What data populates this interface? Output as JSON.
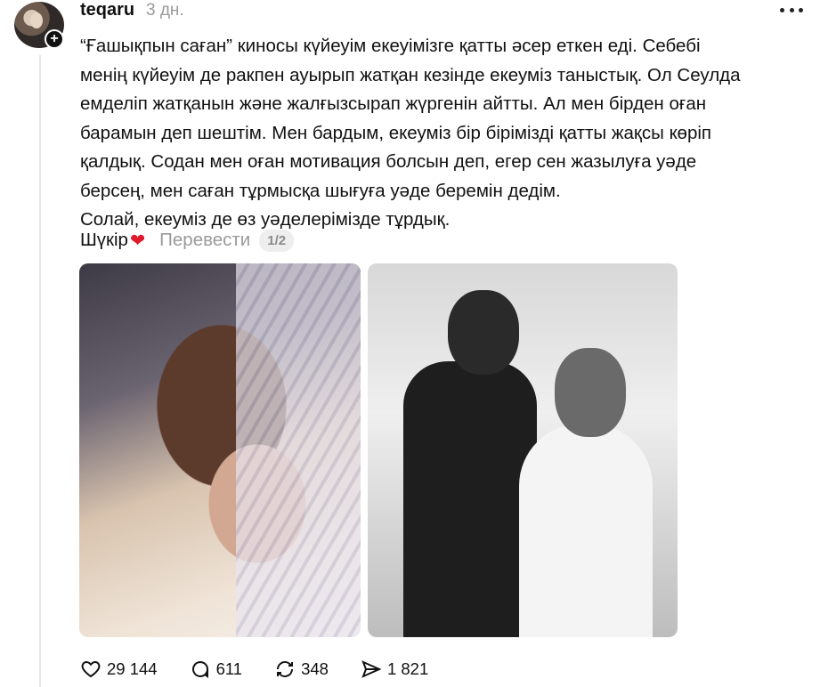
{
  "post": {
    "username": "teqaru",
    "timestamp": "3 дн.",
    "text": "“Ғашықпын саған” киносы күйеуім екеуімізге қатты әсер еткен еді. Себебі\nменің күйеуім де ракпен ауырып жатқан кезінде екеуміз таныстық. Ол Сеулда\nемделіп жатқанын және жалғызсырап жүргенін айтты. Ал мен бірден оған\nбарамын деп шештім. Мен бардым, екеуміз бір бірімізді қатты жақсы көріп\nқалдық. Содан мен оған мотивация болсын деп, егер сен жазылуға уәде\nберсең, мен саған тұрмысқа шығуға уәде беремін дедім.\nСолай, екеуміз де өз уәделерімізде тұрдық.",
    "closing": "Шүкір",
    "heart_icon": "heart-emoji",
    "translate_label": "Перевести",
    "page_indicator": "1/2"
  },
  "media": [
    {
      "name": "selfie-photo"
    },
    {
      "name": "wedding-dance-photo"
    }
  ],
  "actions": {
    "likes": "29 144",
    "comments": "611",
    "reposts": "348",
    "shares": "1 821"
  },
  "colors": {
    "heart": "#e0192c",
    "muted_text": "#9a9a9a",
    "thread_line": "#e6e6e6"
  }
}
